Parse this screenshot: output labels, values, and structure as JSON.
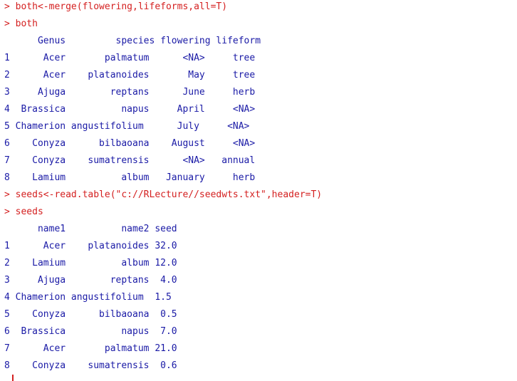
{
  "console": {
    "colors": {
      "command": "#d42020",
      "output": "#1a1aa6",
      "background": "#ffffff"
    },
    "lines": [
      {
        "kind": "cmd",
        "text": "> both<-merge(flowering,lifeforms,all=T)"
      },
      {
        "kind": "cmd",
        "text": "> both"
      },
      {
        "kind": "out",
        "text": "      Genus         species flowering lifeform"
      },
      {
        "kind": "out",
        "text": "1      Acer       palmatum      <NA>     tree"
      },
      {
        "kind": "out",
        "text": "2      Acer    platanoides       May     tree"
      },
      {
        "kind": "out",
        "text": "3     Ajuga        reptans      June     herb"
      },
      {
        "kind": "out",
        "text": "4  Brassica          napus     April     <NA>"
      },
      {
        "kind": "out",
        "text": "5 Chamerion angustifolium      July     <NA>"
      },
      {
        "kind": "out",
        "text": "6    Conyza      bilbaoana    August     <NA>"
      },
      {
        "kind": "out",
        "text": "7    Conyza    sumatrensis      <NA>   annual"
      },
      {
        "kind": "out",
        "text": "8    Lamium          album   January     herb"
      },
      {
        "kind": "cmd",
        "text": "> seeds<-read.table(\"c://RLecture//seedwts.txt\",header=T)"
      },
      {
        "kind": "cmd",
        "text": "> seeds"
      },
      {
        "kind": "out",
        "text": "      name1          name2 seed"
      },
      {
        "kind": "out",
        "text": "1      Acer    platanoides 32.0"
      },
      {
        "kind": "out",
        "text": "2    Lamium          album 12.0"
      },
      {
        "kind": "out",
        "text": "3     Ajuga        reptans  4.0"
      },
      {
        "kind": "out",
        "text": "4 Chamerion angustifolium  1.5"
      },
      {
        "kind": "out",
        "text": "5    Conyza      bilbaoana  0.5"
      },
      {
        "kind": "out",
        "text": "6  Brassica          napus  7.0"
      },
      {
        "kind": "out",
        "text": "7      Acer       palmatum 21.0"
      },
      {
        "kind": "out",
        "text": "8    Conyza    sumatrensis  0.6"
      }
    ]
  }
}
